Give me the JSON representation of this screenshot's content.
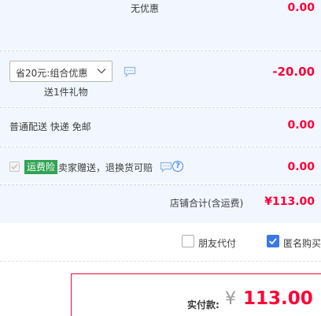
{
  "discount": {
    "label": "无优惠",
    "amount": "0.00"
  },
  "promo": {
    "select_value": "省20元:组合优惠",
    "gift": "送1件礼物",
    "amount": "-20.00"
  },
  "shipping": {
    "label": "普通配送 快递 免邮",
    "amount": "0.00"
  },
  "insurance": {
    "badge": "运费险",
    "text": "卖家赠送，退换货可赔",
    "help": "?",
    "amount": "0.00"
  },
  "subtotal": {
    "label": "店铺合计(含运费)",
    "amount": "¥113.00"
  },
  "options": {
    "friend_pay": {
      "label": "朋友代付",
      "checked": false
    },
    "anonymous": {
      "label": "匿名购买",
      "checked": true
    }
  },
  "payment": {
    "label": "实付款:",
    "currency": "¥",
    "amount": "113.00"
  },
  "colors": {
    "accent_red": "#ff0036",
    "panel_bg": "#f2f7ff",
    "badge_green": "#31a354",
    "check_blue": "#3b78e7"
  },
  "icons": [
    "chevron-down-icon",
    "chat-icon",
    "question-icon",
    "checkbox-icon"
  ]
}
